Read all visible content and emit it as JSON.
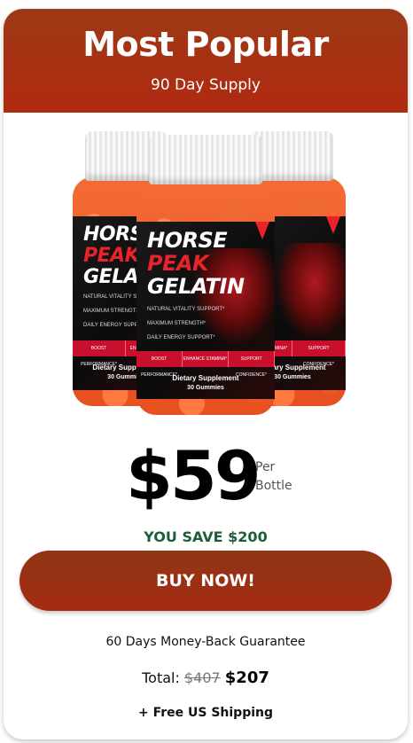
{
  "header": {
    "title": "Most Popular",
    "subtitle": "90 Day Supply"
  },
  "product": {
    "brand_line1": "HORSE",
    "brand_line2": "PEAK",
    "brand_line3": "GELATIN",
    "features": [
      "NATURAL VITALITY SUPPORT*",
      "MAXIMUM STRENGTH*",
      "DAILY ENERGY SUPPORT*"
    ],
    "band": [
      "BOOST PERFORMANCE*",
      "ENHANCE STAMINA*",
      "SUPPORT CONFIDENCE*"
    ],
    "supplement_label": "Dietary Supplement",
    "count_label": "30 Gummies",
    "bottle_count": 3
  },
  "pricing": {
    "price": "$59",
    "per_line1": "Per",
    "per_line2": "Bottle",
    "savings": "YOU SAVE $200",
    "buy_label": "BUY NOW!",
    "guarantee": "60 Days Money-Back Guarantee",
    "total_label": "Total:",
    "total_old": "$407",
    "total_new": "$207",
    "shipping": "+ Free US Shipping"
  },
  "colors": {
    "header_bg": "#a83012",
    "button_bg": "#a52b12",
    "savings_text": "#1d5e3a",
    "brand_red": "#e8232a"
  }
}
